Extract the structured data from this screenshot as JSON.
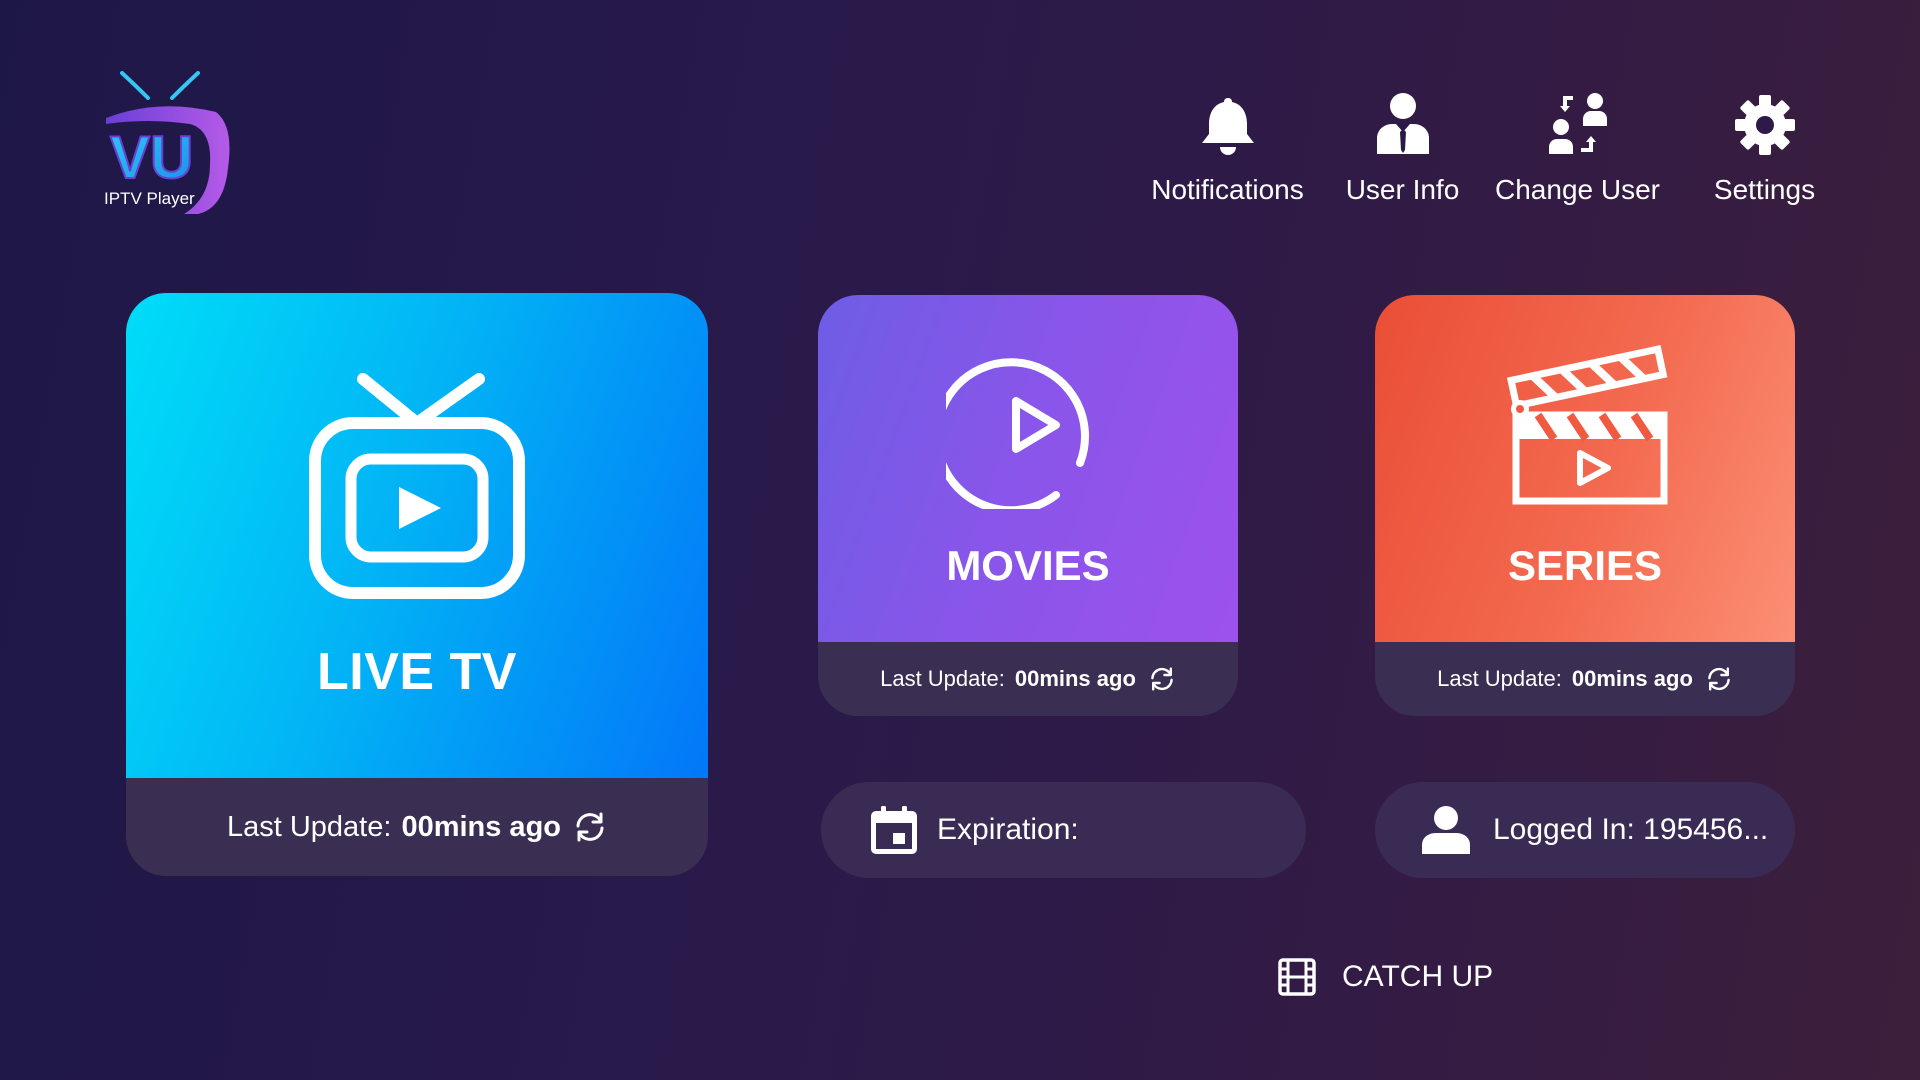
{
  "app": {
    "logo_text": "VU",
    "logo_subtext": "IPTV Player"
  },
  "nav": {
    "items": [
      {
        "label": "Notifications",
        "icon": "bell-icon"
      },
      {
        "label": "User Info",
        "icon": "user-tie-icon"
      },
      {
        "label": "Change User",
        "icon": "switch-user-icon"
      },
      {
        "label": "Settings",
        "icon": "gear-icon"
      }
    ]
  },
  "tiles": {
    "live_tv": {
      "title": "LIVE TV",
      "icon": "tv-play-icon",
      "last_update_label": "Last Update:",
      "last_update_value": "00mins ago"
    },
    "movies": {
      "title": "MOVIES",
      "icon": "play-circle-icon",
      "last_update_label": "Last Update:",
      "last_update_value": "00mins ago"
    },
    "series": {
      "title": "SERIES",
      "icon": "clapperboard-icon",
      "last_update_label": "Last Update:",
      "last_update_value": "00mins ago"
    }
  },
  "info": {
    "expiration_label": "Expiration:",
    "logged_in_label": "Logged In: 195456..."
  },
  "catchup": {
    "label": "CATCH UP",
    "icon": "film-icon"
  },
  "colors": {
    "live_tv_start": "#00ddf8",
    "live_tv_end": "#0377f8",
    "movies_start": "#6e5de5",
    "movies_end": "#9d52ec",
    "series_start": "#ea4e36",
    "series_end": "#fb8f74",
    "footer_bg": "#3a2e52",
    "background_start": "#1d1747",
    "background_end": "#3c1f3a"
  }
}
